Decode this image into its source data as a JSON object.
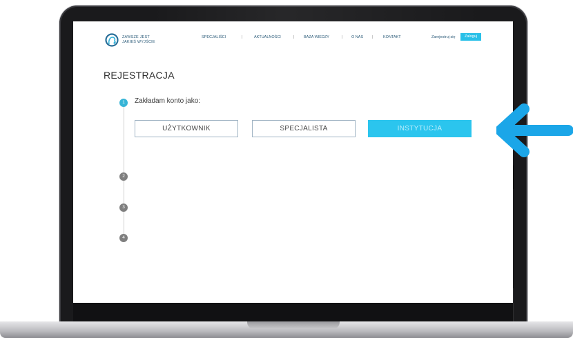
{
  "brand": {
    "line1": "ZAWSZE JEST",
    "line2": "JAKIEŚ WYJŚCIE",
    "logo_icon": "head-profile-logo"
  },
  "nav": {
    "items": [
      "SPECJALIŚCI",
      "AKTUALNOŚCI",
      "BAZA WIEDZY",
      "O NAS",
      "KONTAKT"
    ],
    "separator": "|",
    "signup": "Zarejestruj się",
    "login": "Zaloguj"
  },
  "page": {
    "title": "REJESTRACJA"
  },
  "steps": {
    "numbers": [
      "1",
      "2",
      "3",
      "4"
    ],
    "active": "1",
    "step1_label": "Zakładam konto jako:"
  },
  "account_types": {
    "options": [
      "UŻYTKOWNIK",
      "SPECJALISTA",
      "INSTYTUCJA"
    ],
    "selected": "INSTYTUCJA"
  },
  "colors": {
    "accent": "#29c0e8",
    "step_active": "#36b4d6",
    "step_inactive": "#7f7f7f",
    "arrow": "#1ba6e8"
  },
  "annotation": {
    "icon": "arrow-left-icon"
  }
}
